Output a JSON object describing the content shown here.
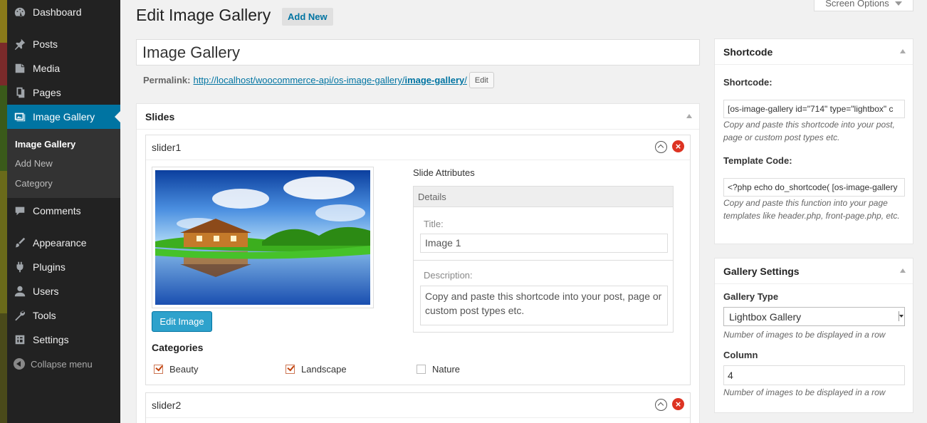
{
  "menu": {
    "items": [
      {
        "label": "Dashboard",
        "icon": "dashboard-icon"
      },
      {
        "label": "Posts",
        "icon": "pin-icon"
      },
      {
        "label": "Media",
        "icon": "media-icon"
      },
      {
        "label": "Pages",
        "icon": "pages-icon"
      },
      {
        "label": "Image Gallery",
        "icon": "gallery-icon"
      },
      {
        "label": "Comments",
        "icon": "comment-icon"
      },
      {
        "label": "Appearance",
        "icon": "brush-icon"
      },
      {
        "label": "Plugins",
        "icon": "plugin-icon"
      },
      {
        "label": "Users",
        "icon": "user-icon"
      },
      {
        "label": "Tools",
        "icon": "wrench-icon"
      },
      {
        "label": "Settings",
        "icon": "settings-icon"
      }
    ],
    "submenu": [
      "Image Gallery",
      "Add New",
      "Category"
    ],
    "collapse": "Collapse menu",
    "accent": "#0074a2"
  },
  "header": {
    "title": "Edit Image Gallery",
    "add_new": "Add New",
    "screen_options": "Screen Options"
  },
  "post": {
    "title": "Image Gallery",
    "permalink_label": "Permalink:",
    "permalink_base": "http://localhost/woocommerce-api/os-image-gallery/",
    "permalink_slug": "image-gallery",
    "permalink_tail": "/",
    "permalink_edit": "Edit"
  },
  "slides": {
    "heading": "Slides",
    "items": [
      {
        "name": "slider1",
        "edit_image": "Edit Image",
        "categories_title": "Categories",
        "categories": [
          {
            "label": "Beauty",
            "checked": true
          },
          {
            "label": "Landscape",
            "checked": true
          },
          {
            "label": "Nature",
            "checked": false
          }
        ],
        "attributes_title": "Slide Attributes",
        "details_title": "Details",
        "title_label": "Title:",
        "title_value": "Image 1",
        "description_label": "Description:",
        "description_value": "Copy and paste this shortcode into your post, page or custom post types etc."
      },
      {
        "name": "slider2"
      }
    ]
  },
  "shortcode_box": {
    "heading": "Shortcode",
    "shortcode_label": "Shortcode:",
    "shortcode_value": "[os-image-gallery id=\"714\" type=\"lightbox\" c",
    "shortcode_help": "Copy and paste this shortcode into your post, page or custom post types etc.",
    "template_label": "Template Code:",
    "template_value": "<?php echo do_shortcode( [os-image-gallery",
    "template_help": "Copy and paste this function into your page templates like header.php, front-page.php, etc."
  },
  "gallery_settings": {
    "heading": "Gallery Settings",
    "type_label": "Gallery Type",
    "type_value": "Lightbox Gallery",
    "type_help": "Number of images to be displayed in a row",
    "column_label": "Column",
    "column_value": "4",
    "column_help": "Number of images to be displayed in a row"
  }
}
